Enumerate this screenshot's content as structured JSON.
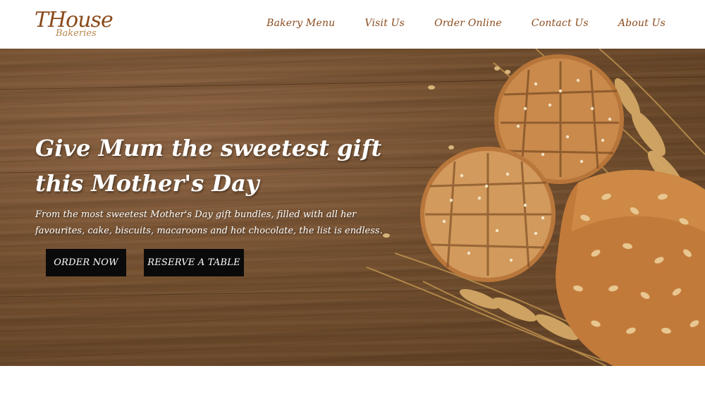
{
  "brand": {
    "name": "THouse",
    "tagline": "Bakeries"
  },
  "nav": {
    "items": [
      {
        "label": "Bakery Menu"
      },
      {
        "label": "Visit Us"
      },
      {
        "label": "Order Online"
      },
      {
        "label": "Contact Us"
      },
      {
        "label": "About Us"
      }
    ]
  },
  "hero": {
    "title": "Give Mum the sweetest gift this Mother's Day",
    "subtitle": "From the most sweetest Mother's Day gift bundles, filled with all her favourites, cake, biscuits, macaroons and hot chocolate, the list is endless.",
    "order_button": "ORDER NOW",
    "reserve_button": "RESERVE A TABLE"
  },
  "colors": {
    "brand": "#8a4a1c",
    "button_bg": "#0b0a0a",
    "wood": "#74502f"
  },
  "icons": {
    "hero_image": "bread-and-wheat-illustration"
  }
}
